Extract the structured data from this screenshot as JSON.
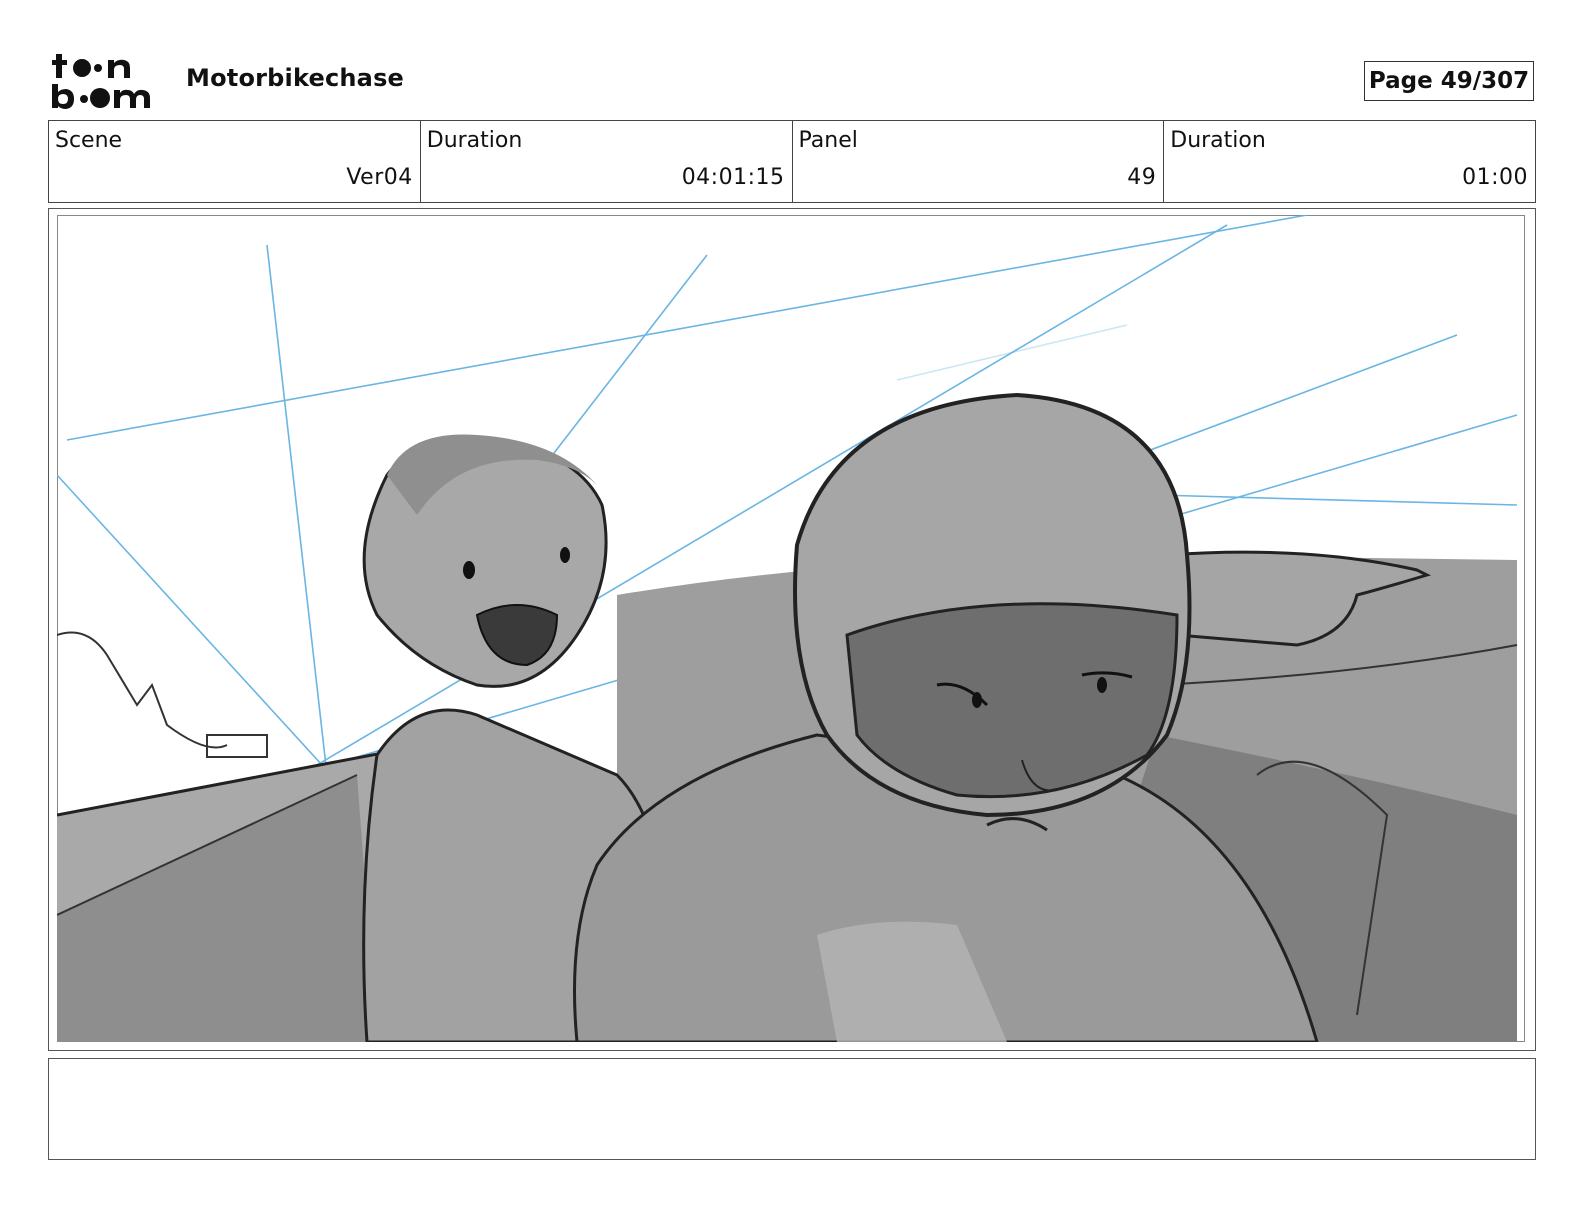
{
  "header": {
    "logo_text": "toonboom",
    "project_title": "Motorbikechase",
    "page_label": "Page",
    "page_number": "49/307"
  },
  "info": {
    "scene_label": "Scene",
    "scene_value": "Ver04",
    "scene_duration_label": "Duration",
    "scene_duration_value": "04:01:15",
    "panel_label": "Panel",
    "panel_value": "49",
    "panel_duration_label": "Duration",
    "panel_duration_value": "01:00"
  },
  "panel": {
    "image_icon": "storyboard-sketch-image"
  },
  "notes": {
    "text": ""
  }
}
